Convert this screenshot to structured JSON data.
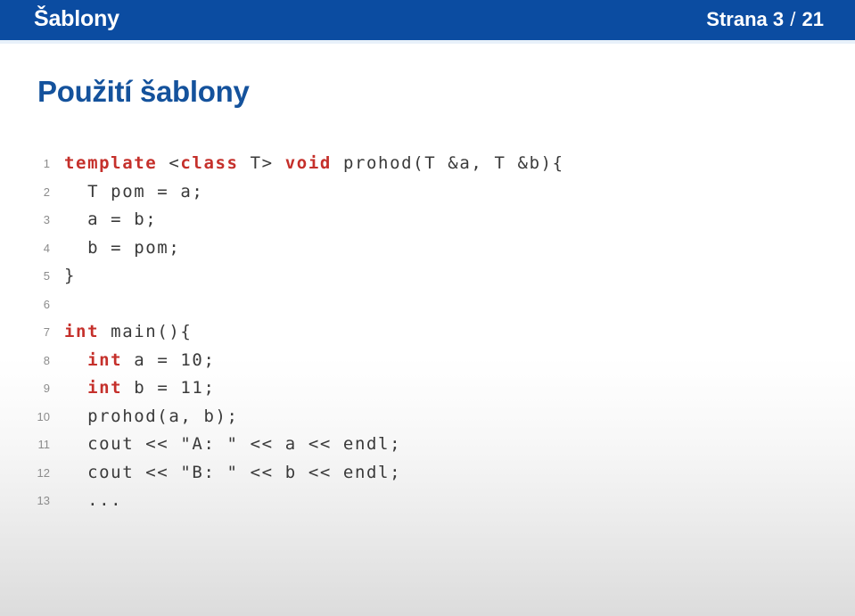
{
  "header": {
    "title": "Šablony",
    "page_label": "Strana",
    "page_current": "3",
    "page_separator": "/",
    "page_total": "21",
    "page_info": "Strana 3 / 21",
    "background_color": "#0b4ca1",
    "text_color": "#ffffff"
  },
  "slide": {
    "title": "Použití šablony",
    "title_color": "#14529c",
    "background_color": "#ffffff"
  },
  "code": {
    "language": "cpp",
    "keyword_color": "#c5302b",
    "text_color": "#3a3a3a",
    "line_number_color": "#8c8c8c",
    "lines": [
      {
        "n": "1",
        "text": "template <class T> void prohod(T &a, T &b){",
        "segments": [
          {
            "t": "template",
            "k": true
          },
          {
            "t": " <",
            "k": false
          },
          {
            "t": "class",
            "k": true
          },
          {
            "t": " T> ",
            "k": false
          },
          {
            "t": "void",
            "k": true
          },
          {
            "t": " prohod(T &a, T &b){",
            "k": false
          }
        ]
      },
      {
        "n": "2",
        "text": "  T pom = a;",
        "segments": [
          {
            "t": "  T pom = a;",
            "k": false
          }
        ]
      },
      {
        "n": "3",
        "text": "  a = b;",
        "segments": [
          {
            "t": "  a = b;",
            "k": false
          }
        ]
      },
      {
        "n": "4",
        "text": "  b = pom;",
        "segments": [
          {
            "t": "  b = pom;",
            "k": false
          }
        ]
      },
      {
        "n": "5",
        "text": "}",
        "segments": [
          {
            "t": "}",
            "k": false
          }
        ]
      },
      {
        "n": "6",
        "text": "",
        "segments": []
      },
      {
        "n": "7",
        "text": "int main(){",
        "segments": [
          {
            "t": "int",
            "k": true
          },
          {
            "t": " main(){",
            "k": false
          }
        ]
      },
      {
        "n": "8",
        "text": "  int a = 10;",
        "segments": [
          {
            "t": "  ",
            "k": false
          },
          {
            "t": "int",
            "k": true
          },
          {
            "t": " a = 10;",
            "k": false
          }
        ]
      },
      {
        "n": "9",
        "text": "  int b = 11;",
        "segments": [
          {
            "t": "  ",
            "k": false
          },
          {
            "t": "int",
            "k": true
          },
          {
            "t": " b = 11;",
            "k": false
          }
        ]
      },
      {
        "n": "10",
        "text": "  prohod(a, b);",
        "segments": [
          {
            "t": "  prohod(a, b);",
            "k": false
          }
        ]
      },
      {
        "n": "11",
        "text": "  cout << \"A: \" << a << endl;",
        "segments": [
          {
            "t": "  cout << \"A: \" << a << endl;",
            "k": false
          }
        ]
      },
      {
        "n": "12",
        "text": "  cout << \"B: \" << b << endl;",
        "segments": [
          {
            "t": "  cout << \"B: \" << b << endl;",
            "k": false
          }
        ]
      },
      {
        "n": "13",
        "text": "  ...",
        "segments": [
          {
            "t": "  ...",
            "k": false
          }
        ]
      }
    ]
  }
}
